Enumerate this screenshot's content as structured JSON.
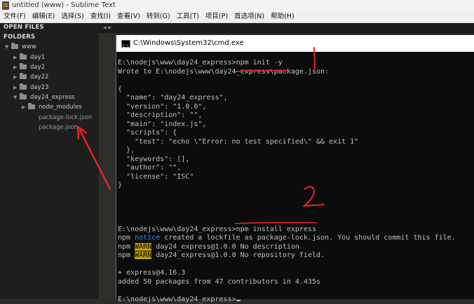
{
  "window": {
    "title": "untitled (www) - Sublime Text"
  },
  "menu": [
    "文件(F)",
    "编辑(E)",
    "选择(S)",
    "查找(I)",
    "查看(V)",
    "转到(G)",
    "工具(T)",
    "项目(P)",
    "首选项(N)",
    "帮助(H)"
  ],
  "sidebar": {
    "open_files_label": "OPEN FILES",
    "folders_label": "FOLDERS",
    "root": "www",
    "folders": [
      "day1",
      "day2",
      "day22",
      "day23"
    ],
    "project": "day24_express",
    "subfolder": "node_modules",
    "files": [
      "package-lock.json",
      "package.json"
    ]
  },
  "editor": {
    "tab_nav": "◂ ▸"
  },
  "cmd": {
    "title": "C:\\Windows\\System32\\cmd.exe",
    "icon_text": "C:\\",
    "lines": [
      "E:\\nodejs\\www\\day24_express>npm init -y",
      "Wrote to E:\\nodejs\\www\\day24_express\\package.json:",
      "",
      "{",
      "  \"name\": \"day24_express\",",
      "  \"version\": \"1.0.0\",",
      "  \"description\": \"\",",
      "  \"main\": \"index.js\",",
      "  \"scripts\": {",
      "    \"test\": \"echo \\\"Error: no test specified\\\" && exit 1\"",
      "  },",
      "  \"keywords\": [],",
      "  \"author\": \"\",",
      "  \"license\": \"ISC\"",
      "}",
      "",
      "",
      "",
      "",
      "E:\\nodejs\\www\\day24_express>npm install express"
    ],
    "notice_line": {
      "prefix": "npm ",
      "tag": "notice",
      "text": " created a lockfile as package-lock.json. You should commit this file."
    },
    "warn_lines": [
      {
        "prefix": "npm ",
        "tag": "WARN",
        "text": " day24_express@1.0.0 No description"
      },
      {
        "prefix": "npm ",
        "tag": "WARN",
        "text": " day24_express@1.0.0 No repository field."
      }
    ],
    "tail_lines": [
      "",
      "+ express@4.16.3",
      "added 50 packages from 47 contributors in 4.435s",
      "",
      "E:\\nodejs\\www\\day24_express>"
    ]
  },
  "annotations": {
    "mark1": "1",
    "mark2": "2",
    "color": "#e8252a"
  }
}
